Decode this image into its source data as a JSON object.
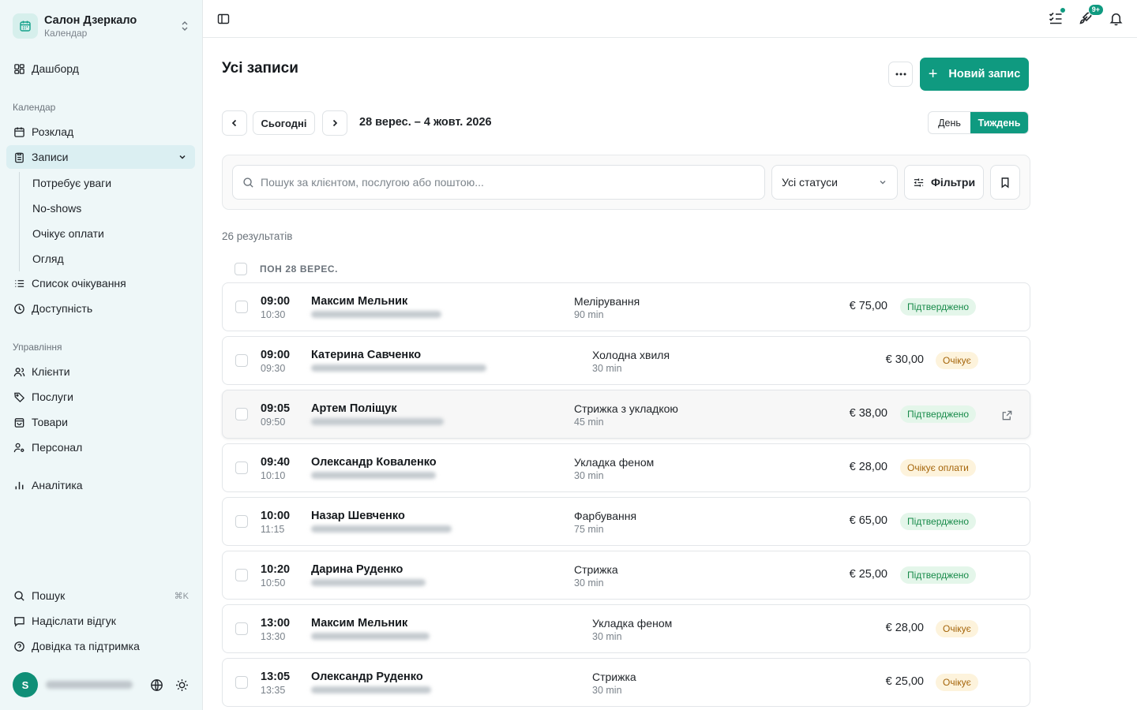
{
  "brand": {
    "name": "Салон Дзеркало",
    "subtitle": "Календар"
  },
  "sidebar": {
    "dashboard": "Дашборд",
    "calendar_section": "Календар",
    "schedule": "Розклад",
    "appointments": "Записи",
    "sub_items": [
      "Потребує уваги",
      "No-shows",
      "Очікує оплати",
      "Огляд"
    ],
    "waitlist": "Список очікування",
    "availability": "Доступність",
    "management_section": "Управління",
    "clients": "Клієнти",
    "services": "Послуги",
    "products": "Товари",
    "staff": "Персонал",
    "analytics": "Аналітика",
    "search": "Пошук",
    "search_shortcut": "⌘K",
    "feedback": "Надіслати відгук",
    "help": "Довідка та підтримка",
    "user_initial": "S"
  },
  "topbar": {
    "notification_count": "9+"
  },
  "page": {
    "title": "Усі записи",
    "new_button": "Новий запис",
    "today_button": "Сьогодні",
    "date_range": "28 верес. – 4 жовт. 2026",
    "view_day": "День",
    "view_week": "Тиждень",
    "search_placeholder": "Пошук за клієнтом, послугою або поштою...",
    "status_select": "Усі статуси",
    "filters_button": "Фільтри",
    "results_count": "26 результатів",
    "day_header": "ПОН 28 ВЕРЕС."
  },
  "appointments": [
    {
      "start": "09:00",
      "end": "10:30",
      "client": "Максим Мельник",
      "service": "Мелірування",
      "duration": "90 min",
      "price": "€ 75,00",
      "status": "Підтверджено",
      "status_kind": "ok"
    },
    {
      "start": "09:00",
      "end": "09:30",
      "client": "Катерина Савченко",
      "service": "Холодна хвиля",
      "duration": "30 min",
      "price": "€ 30,00",
      "status": "Очікує",
      "status_kind": "wait"
    },
    {
      "start": "09:05",
      "end": "09:50",
      "client": "Артем Поліщук",
      "service": "Стрижка з укладкою",
      "duration": "45 min",
      "price": "€ 38,00",
      "status": "Підтверджено",
      "status_kind": "ok"
    },
    {
      "start": "09:40",
      "end": "10:10",
      "client": "Олександр Коваленко",
      "service": "Укладка феном",
      "duration": "30 min",
      "price": "€ 28,00",
      "status": "Очікує оплати",
      "status_kind": "wait"
    },
    {
      "start": "10:00",
      "end": "11:15",
      "client": "Назар Шевченко",
      "service": "Фарбування",
      "duration": "75 min",
      "price": "€ 65,00",
      "status": "Підтверджено",
      "status_kind": "ok"
    },
    {
      "start": "10:20",
      "end": "10:50",
      "client": "Дарина Руденко",
      "service": "Стрижка",
      "duration": "30 min",
      "price": "€ 25,00",
      "status": "Підтверджено",
      "status_kind": "ok"
    },
    {
      "start": "13:00",
      "end": "13:30",
      "client": "Максим Мельник",
      "service": "Укладка феном",
      "duration": "30 min",
      "price": "€ 28,00",
      "status": "Очікує",
      "status_kind": "wait"
    },
    {
      "start": "13:05",
      "end": "13:35",
      "client": "Олександр Руденко",
      "service": "Стрижка",
      "duration": "30 min",
      "price": "€ 25,00",
      "status": "Очікує",
      "status_kind": "wait"
    }
  ],
  "colors": {
    "accent": "#0f9a80",
    "sidebar_bg": "#eef7f8",
    "confirmed": "#178a49",
    "pending": "#a5650a"
  }
}
